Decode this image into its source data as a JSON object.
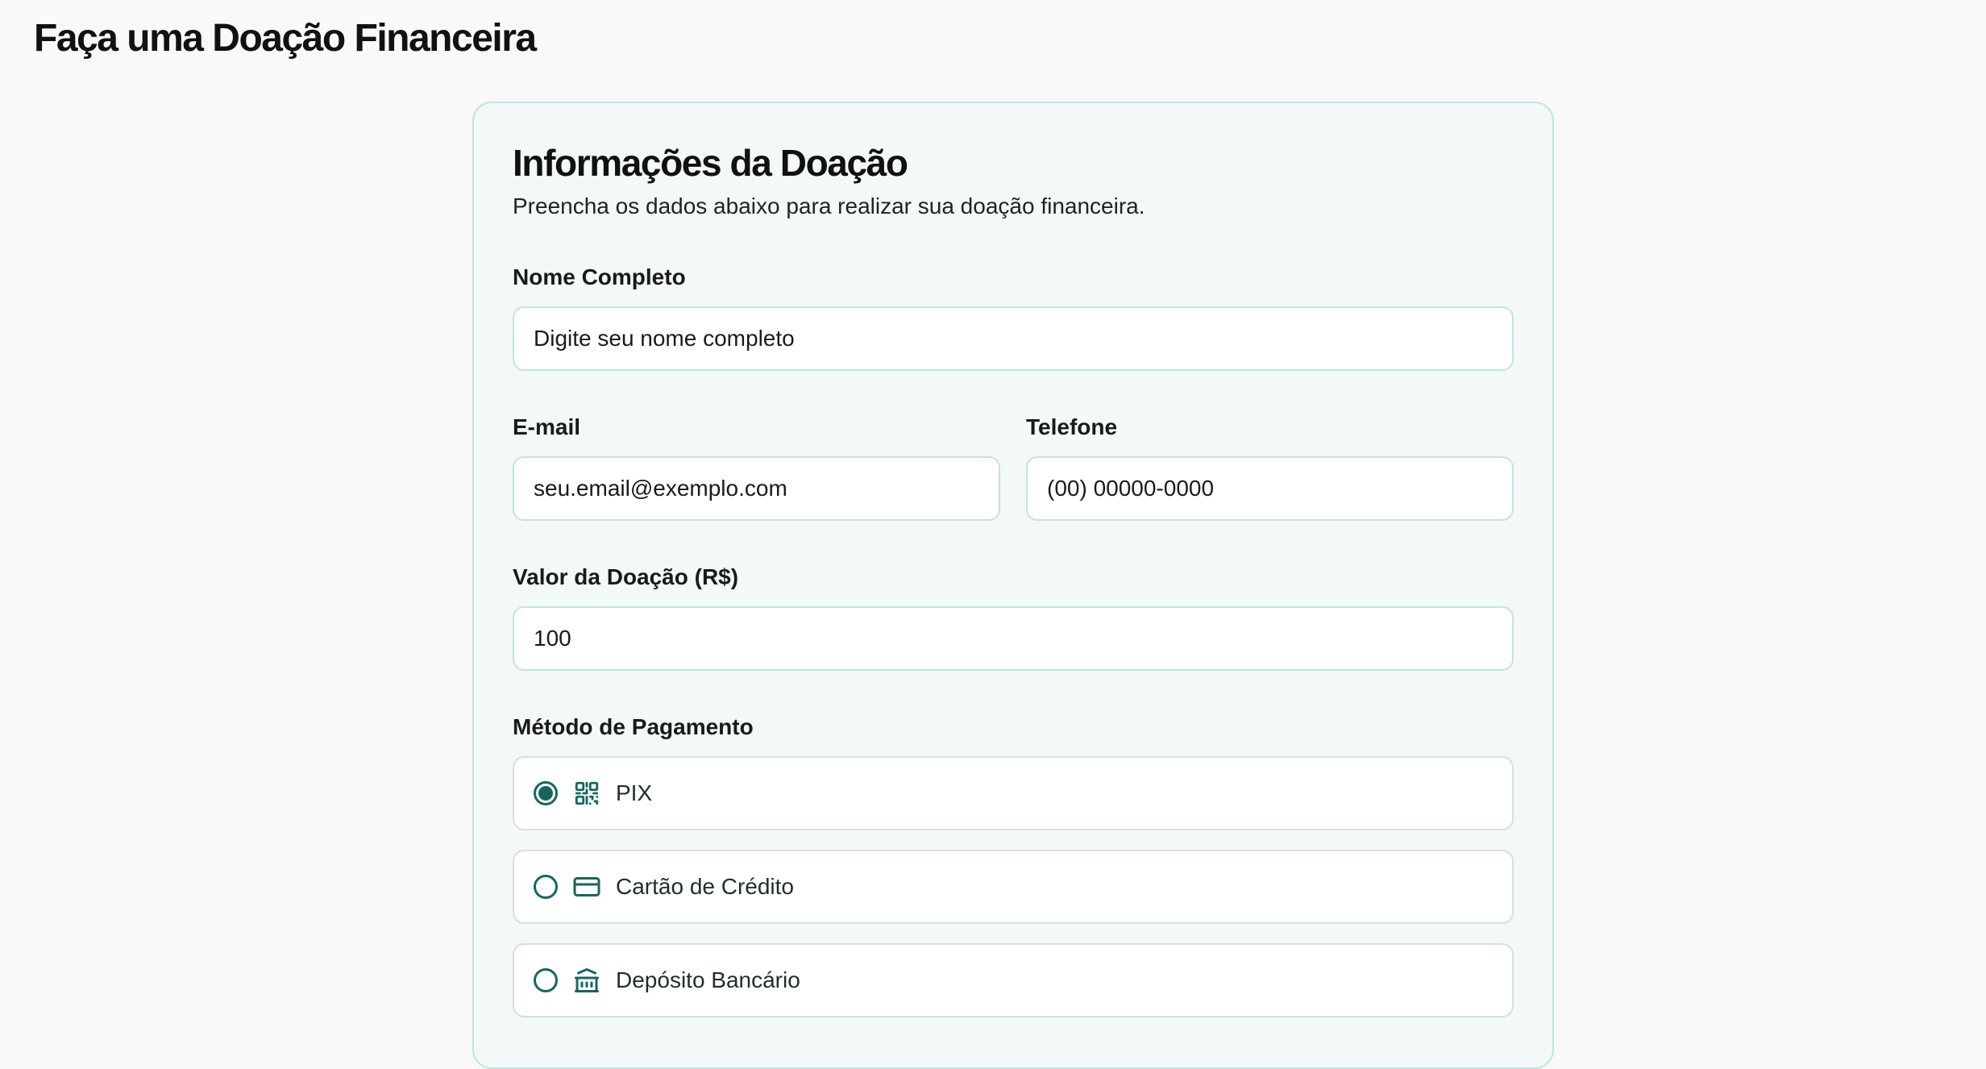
{
  "page": {
    "title": "Faça uma Doação Financeira"
  },
  "card": {
    "title": "Informações da Doação",
    "subtitle": "Preencha os dados abaixo para realizar sua doação financeira."
  },
  "form": {
    "name": {
      "label": "Nome Completo",
      "placeholder": "Digite seu nome completo",
      "value": ""
    },
    "email": {
      "label": "E-mail",
      "placeholder": "seu.email@exemplo.com",
      "value": ""
    },
    "phone": {
      "label": "Telefone",
      "placeholder": "(00) 00000-0000",
      "value": ""
    },
    "amount": {
      "label": "Valor da Doação (R$)",
      "placeholder": "",
      "value": "100"
    },
    "payment": {
      "label": "Método de Pagamento",
      "selected": "PIX",
      "options": [
        {
          "label": "PIX",
          "icon": "qr-code-icon"
        },
        {
          "label": "Cartão de Crédito",
          "icon": "credit-card-icon"
        },
        {
          "label": "Depósito Bancário",
          "icon": "bank-icon"
        }
      ]
    }
  },
  "colors": {
    "accent": "#17665e",
    "card_background": "#f3f9f8",
    "card_border": "#bfe6df",
    "page_background": "#f9f9f9"
  }
}
